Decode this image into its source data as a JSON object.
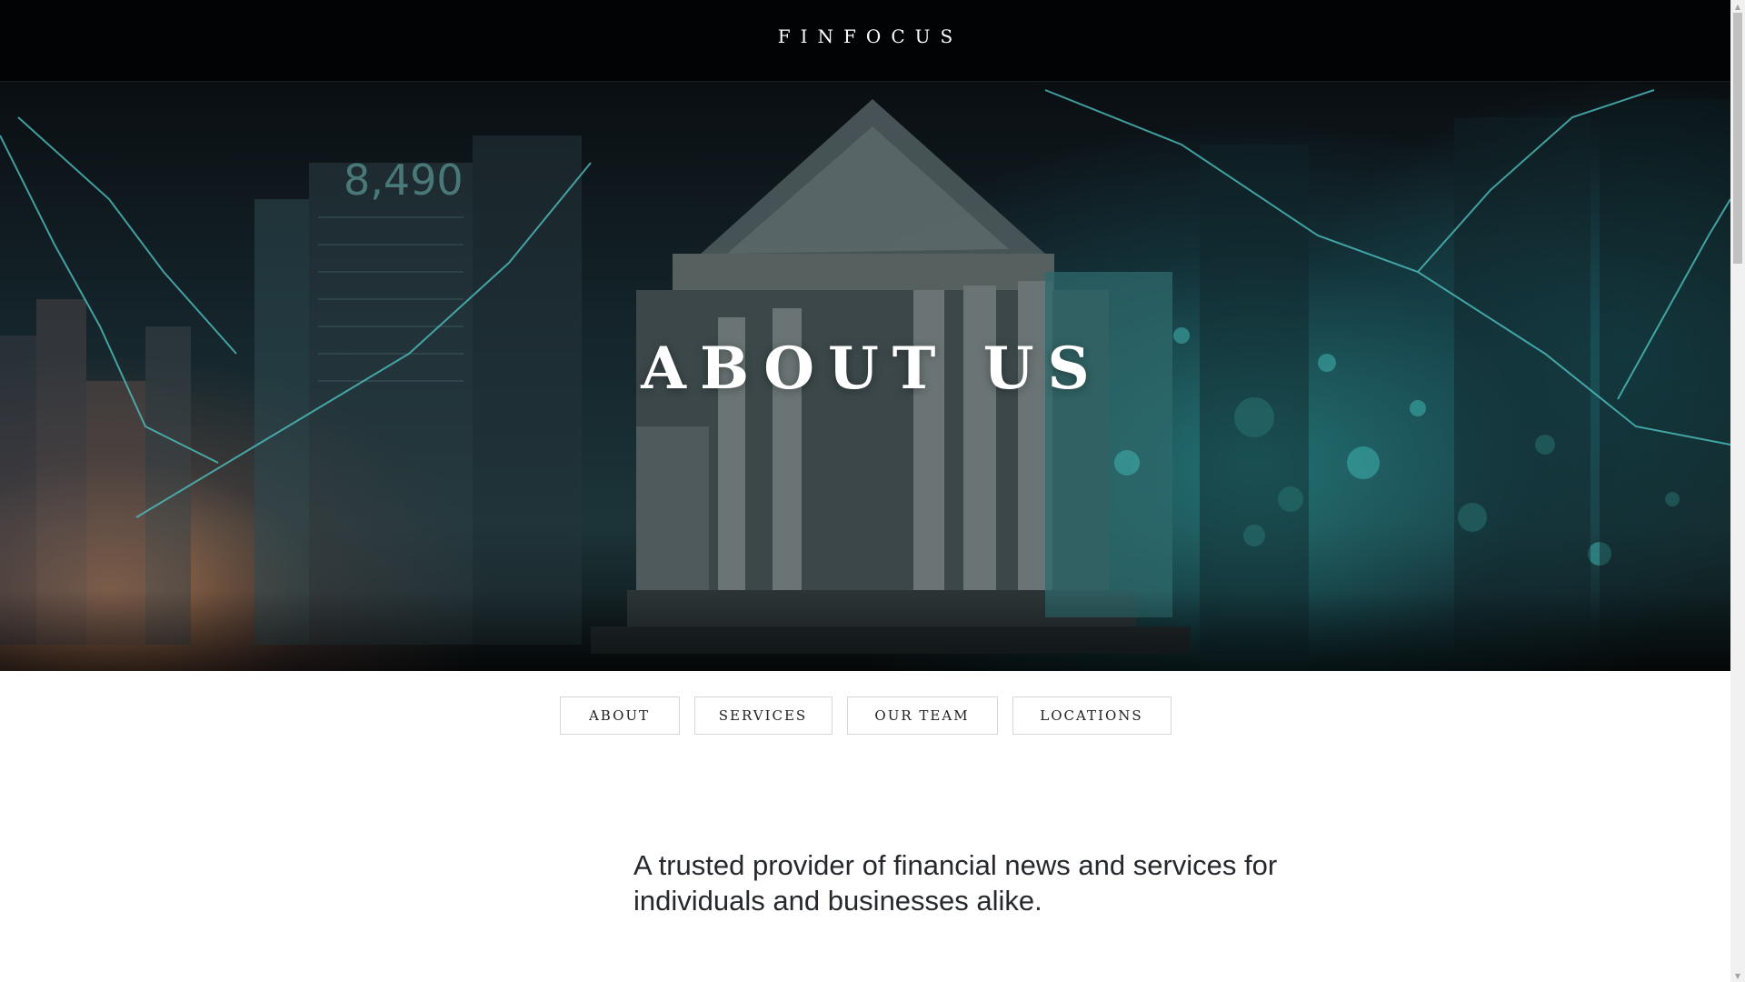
{
  "header": {
    "logo": "FINFOCUS"
  },
  "hero": {
    "title": "ABOUT US",
    "background_icon": "bank-building-collage-image",
    "sign_text_left": "8,490"
  },
  "section_nav": {
    "items": [
      {
        "label": "ABOUT"
      },
      {
        "label": "SERVICES"
      },
      {
        "label": "OUR TEAM"
      },
      {
        "label": "LOCATIONS"
      }
    ]
  },
  "intro": {
    "text": "A trusted provider of financial news and services for individuals and businesses alike."
  },
  "colors": {
    "header_bg": "#020305",
    "hero_teal": "#2a9a98",
    "hero_warm": "#d68c5a",
    "text_dark": "#25292e",
    "button_border": "#d6d6d6"
  }
}
